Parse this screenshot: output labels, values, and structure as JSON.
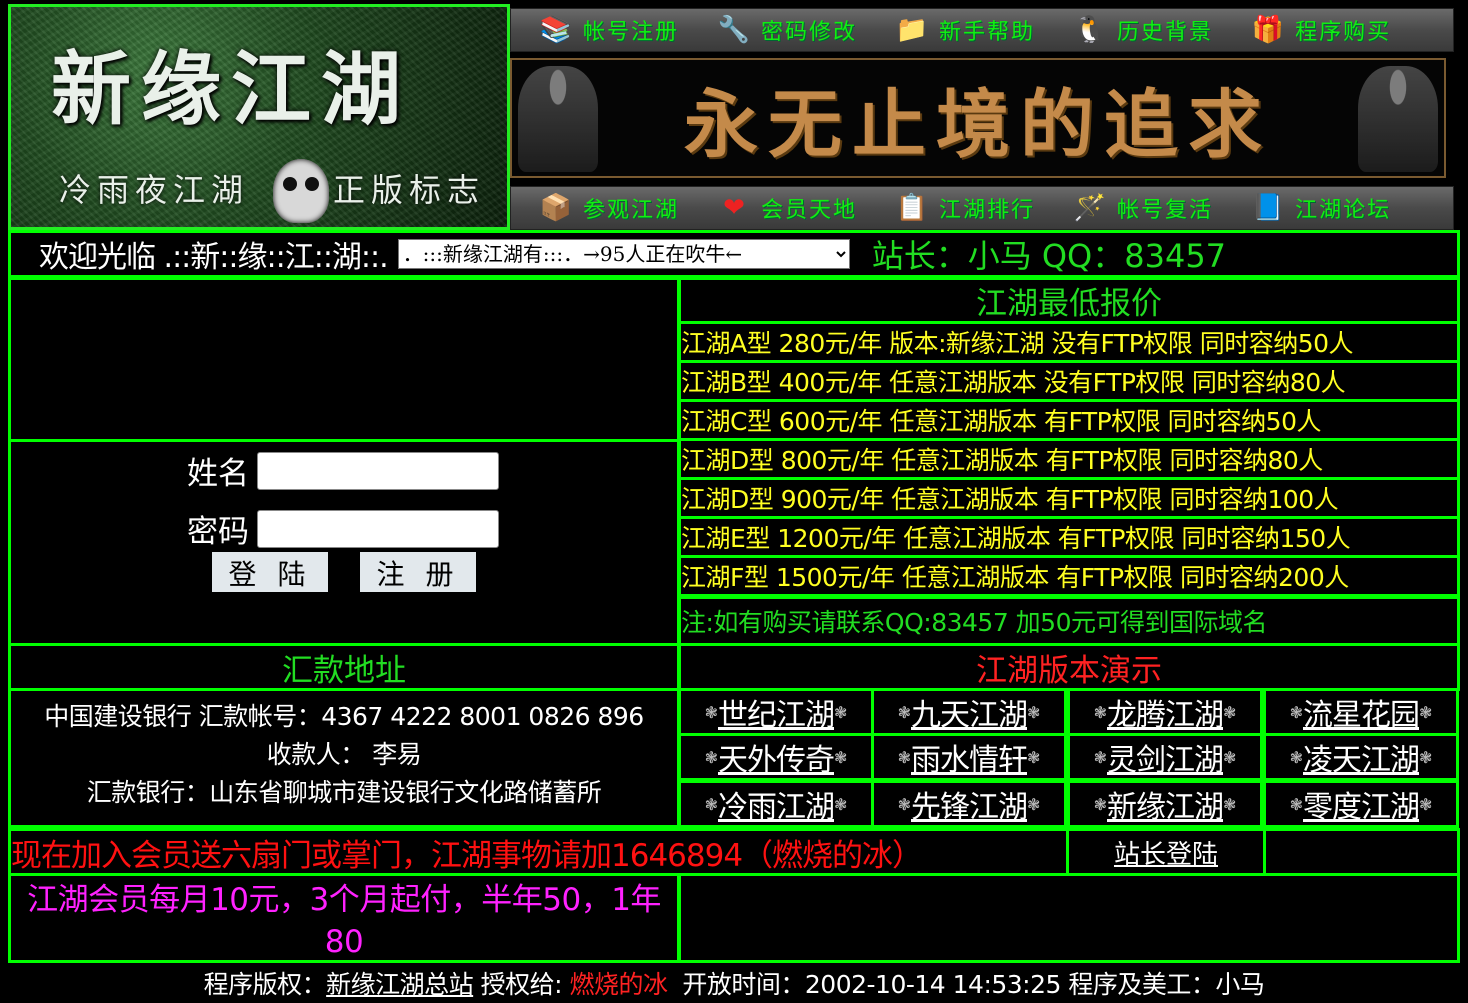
{
  "logo": {
    "title": "新缘江湖",
    "sub_left": "冷雨夜江湖",
    "sub_right": "正版标志"
  },
  "nav_top": [
    {
      "label": "帐号注册",
      "icon": "books-icon"
    },
    {
      "label": "密码修改",
      "icon": "tools-icon"
    },
    {
      "label": "新手帮助",
      "icon": "folder-icon"
    },
    {
      "label": "历史背景",
      "icon": "penguin-icon"
    },
    {
      "label": "程序购买",
      "icon": "gift-icon"
    }
  ],
  "slogan": "永无止境的追求",
  "nav_bottom": [
    {
      "label": "参观江湖",
      "icon": "box-icon"
    },
    {
      "label": "会员天地",
      "icon": "heart-icon"
    },
    {
      "label": "江湖排行",
      "icon": "list-icon"
    },
    {
      "label": "帐号复活",
      "icon": "wand-icon"
    },
    {
      "label": "江湖论坛",
      "icon": "stack-icon"
    }
  ],
  "welcome": {
    "text": "欢迎光临 .::新::缘::江::湖::.",
    "select_value": "．:::新缘江湖有:::．→95人正在吹牛←",
    "admin": "站长：小马 QQ：83457"
  },
  "login": {
    "name_label": "姓名",
    "password_label": "密码",
    "login_button": "登 陆",
    "register_button": "注 册"
  },
  "pricing": {
    "title": "江湖最低报价",
    "rows": [
      "江湖A型 280元/年 版本:新缘江湖 没有FTP权限 同时容纳50人",
      "江湖B型 400元/年 任意江湖版本 没有FTP权限 同时容纳80人",
      "江湖C型 600元/年 任意江湖版本 有FTP权限 同时容纳50人",
      "江湖D型 800元/年 任意江湖版本 有FTP权限 同时容纳80人",
      "江湖D型 900元/年 任意江湖版本 有FTP权限 同时容纳100人",
      "江湖E型 1200元/年 任意江湖版本 有FTP权限 同时容纳150人",
      "江湖F型 1500元/年 任意江湖版本 有FTP权限 同时容纳200人"
    ],
    "note": "注:如有购买请联系QQ:83457 加50元可得到国际域名"
  },
  "remit": {
    "title": "汇款地址",
    "line1": "中国建设银行  汇款帐号：4367 4222 8001 0826 896",
    "line2": "收款人：  李易",
    "line3": "汇款银行：山东省聊城市建设银行文化路储蓄所"
  },
  "demo": {
    "title": "江湖版本演示",
    "ornament": "❃",
    "items": [
      "世纪江湖",
      "九天江湖",
      "龙腾江湖",
      "流星花园",
      "天外传奇",
      "雨水情轩",
      "灵剑江湖",
      "凌天江湖",
      "冷雨江湖",
      "先锋江湖",
      "新缘江湖",
      "零度江湖"
    ]
  },
  "promo": "现在加入会员送六扇门或掌门，江湖事物请加1646894（燃烧的冰）",
  "admin_login": "站长登陆",
  "member": "江湖会员每月10元，3个月起付，半年50，1年80",
  "footer": {
    "copyright_label": "程序版权：",
    "copyright_link": "新缘江湖总站",
    "licensed_label": " 授权给: ",
    "licensee": "燃烧的冰",
    "open_time": "  开放时间：2002-10-14 14:53:25 程序及美工：小马"
  },
  "colors": {
    "border": "#00ff00",
    "green_text": "#22dd22",
    "yellow_text": "#ffff22",
    "red_text": "#ff2222",
    "magenta_text": "#ff22ff"
  }
}
